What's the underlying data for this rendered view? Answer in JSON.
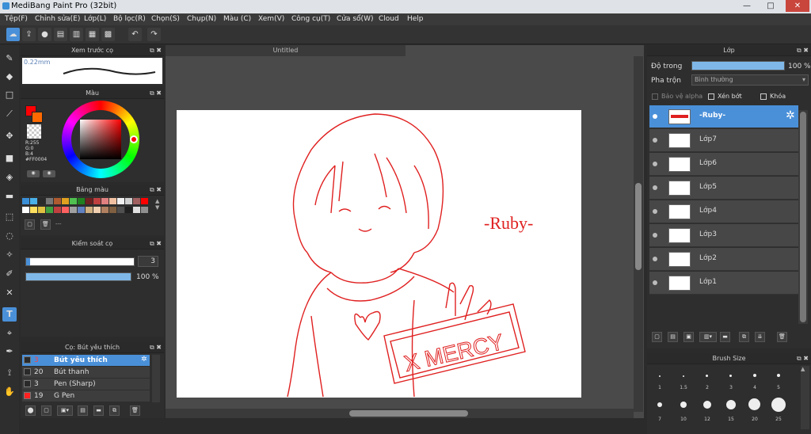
{
  "window": {
    "title": "MediBang Paint Pro (32bit)"
  },
  "menu": [
    "Tệp(F)",
    "Chỉnh sửa(E)",
    "Lớp(L)",
    "Bộ lọc(R)",
    "Chọn(S)",
    "Chụp(N)",
    "Màu (C)",
    "Xem(V)",
    "Công cụ(T)",
    "Cửa sổ(W)",
    "Cloud",
    "Help"
  ],
  "brush_preview": {
    "title": "Xem trước cọ",
    "size": "0.22mm"
  },
  "color": {
    "title": "Màu",
    "r": "R:255",
    "g": "G:0",
    "b": "B:4",
    "hex": "#FF0004",
    "primary": "#ff0004"
  },
  "palette": {
    "title": "Bảng màu",
    "dash": "---"
  },
  "brush_control": {
    "title": "Kiểm soát cọ",
    "size": "3",
    "opacity": "100 %",
    "size_value": 3,
    "opacity_value": 100
  },
  "brushes": {
    "title": "Cọ: Bút yêu thích",
    "items": [
      {
        "size": "3",
        "name": "Bút yêu thích",
        "color": "#2a2a2a"
      },
      {
        "size": "20",
        "name": "Bút thanh",
        "color": "#2a2a2a"
      },
      {
        "size": "3",
        "name": "Pen (Sharp)",
        "color": "#2a2a2a"
      },
      {
        "size": "19",
        "name": "G Pen",
        "color": "#ff2020"
      }
    ]
  },
  "canvas": {
    "tab": "Untitled",
    "text1": "-Ruby-",
    "text2": "X MERCY"
  },
  "layers": {
    "title": "Lớp",
    "opacity_label": "Độ trong",
    "opacity": "100 %",
    "opacity_value": 100,
    "blend_label": "Pha trộn",
    "blend_value": "Bình thường",
    "protect_alpha": "Bảo vệ alpha",
    "clip": "Xén bớt",
    "lock": "Khóa",
    "items": [
      "-Ruby-",
      "Lớp7",
      "Lớp6",
      "Lớp5",
      "Lớp4",
      "Lớp3",
      "Lớp2",
      "Lớp1"
    ]
  },
  "brush_size": {
    "title": "Brush Size",
    "row1": [
      "1",
      "1.5",
      "2",
      "3",
      "4",
      "5"
    ],
    "row2": [
      "7",
      "10",
      "12",
      "15",
      "20",
      "25"
    ]
  }
}
